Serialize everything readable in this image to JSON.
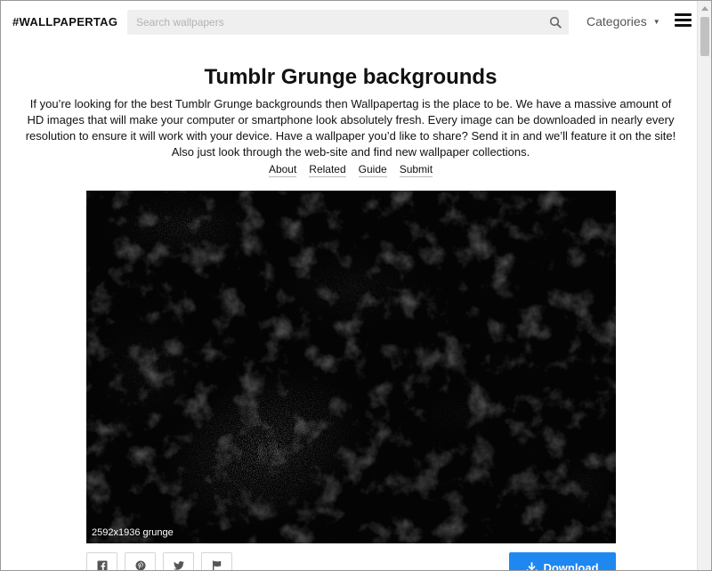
{
  "header": {
    "logo": "#WALLPAPERTAG",
    "search_placeholder": "Search wallpapers",
    "categories_label": "Categories"
  },
  "page": {
    "title": "Tumblr Grunge backgrounds",
    "intro": "If you’re looking for the best Tumblr Grunge backgrounds then Wallpapertag is the place to be. We have a massive amount of HD images that will make your computer or smartphone look absolutely fresh. Every image can be downloaded in nearly every resolution to ensure it will work with your device. Have a wallpaper you’d like to share? Send it in and we’ll feature it on the site! Also just look through the web-site and find new wallpaper collections.",
    "links": [
      "About",
      "Related",
      "Guide",
      "Submit"
    ]
  },
  "wallpaper": {
    "caption": "2592x1936 grunge"
  },
  "actions": {
    "share_icons": [
      "facebook-icon",
      "pinterest-icon",
      "twitter-icon",
      "flag-icon"
    ],
    "download_label": "Download"
  },
  "colors": {
    "accent": "#1f87f0",
    "search_bg": "#efefef"
  }
}
